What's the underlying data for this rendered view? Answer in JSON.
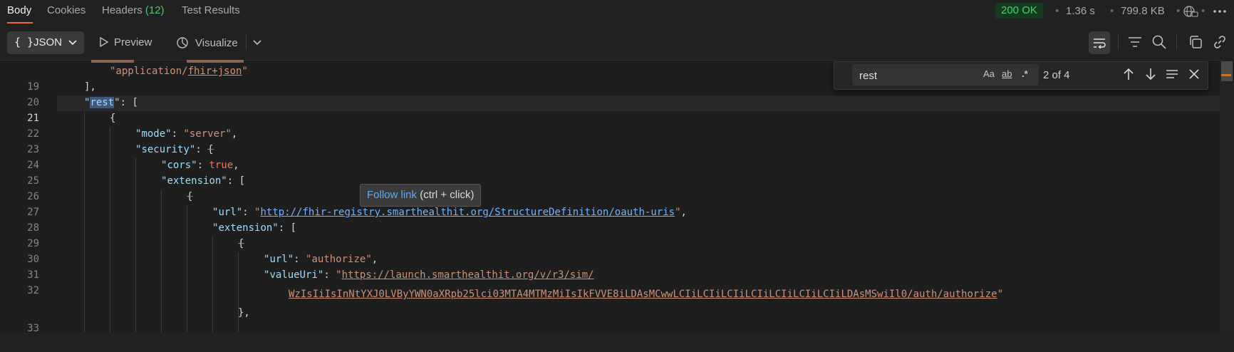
{
  "tabs": [
    {
      "label": "Body"
    },
    {
      "label": "Cookies"
    },
    {
      "label": "Headers",
      "count": "(12)"
    },
    {
      "label": "Test Results"
    }
  ],
  "response": {
    "status": "200 OK",
    "time": "1.36 s",
    "size": "799.8 KB",
    "separator": "•"
  },
  "toolbar": {
    "format_label": "JSON",
    "preview_label": "Preview",
    "visualize_label": "Visualize"
  },
  "find": {
    "query": "rest",
    "case_label": "Aa",
    "word_label": "ab",
    "regex_label": ".*",
    "count": "2 of 4"
  },
  "tooltip": {
    "link": "Follow link",
    "hint": "(ctrl + click)"
  },
  "lines": [
    {
      "n": "19",
      "t1": "\"application/",
      "t2": "fhir+json",
      "t3": "\""
    },
    {
      "n": "20",
      "text": "],"
    },
    {
      "n": "21",
      "key": "rest"
    },
    {
      "n": "22",
      "text": "{"
    },
    {
      "n": "23",
      "key": "mode",
      "value": "\"server\""
    },
    {
      "n": "24",
      "key": "security"
    },
    {
      "n": "25",
      "key": "cors",
      "value": "true"
    },
    {
      "n": "26",
      "key": "extension"
    },
    {
      "n": "27",
      "text": "{"
    },
    {
      "n": "28",
      "key": "url",
      "value": "http://fhir-registry.smarthealthit.org/StructureDefinition/oauth-uris"
    },
    {
      "n": "29",
      "key": "extension"
    },
    {
      "n": "30",
      "text": "{"
    },
    {
      "n": "31",
      "key": "url",
      "value": "\"authorize\""
    },
    {
      "n": "32",
      "key": "valueUri",
      "value1": "https://launch.smarthealthit.org/v/r3/sim/",
      "value2": "WzIsIiIsInNtYXJ0LVByYWN0aXRpb25lci03MTA4MTMzMiIsIkFVVE8iLDAsMCwwLCIiLCIiLCIiLCIiLCIiLCIiLCIiLDAsMSwiIl0/auth/authorize"
    },
    {
      "n": "33",
      "text": "},"
    }
  ]
}
